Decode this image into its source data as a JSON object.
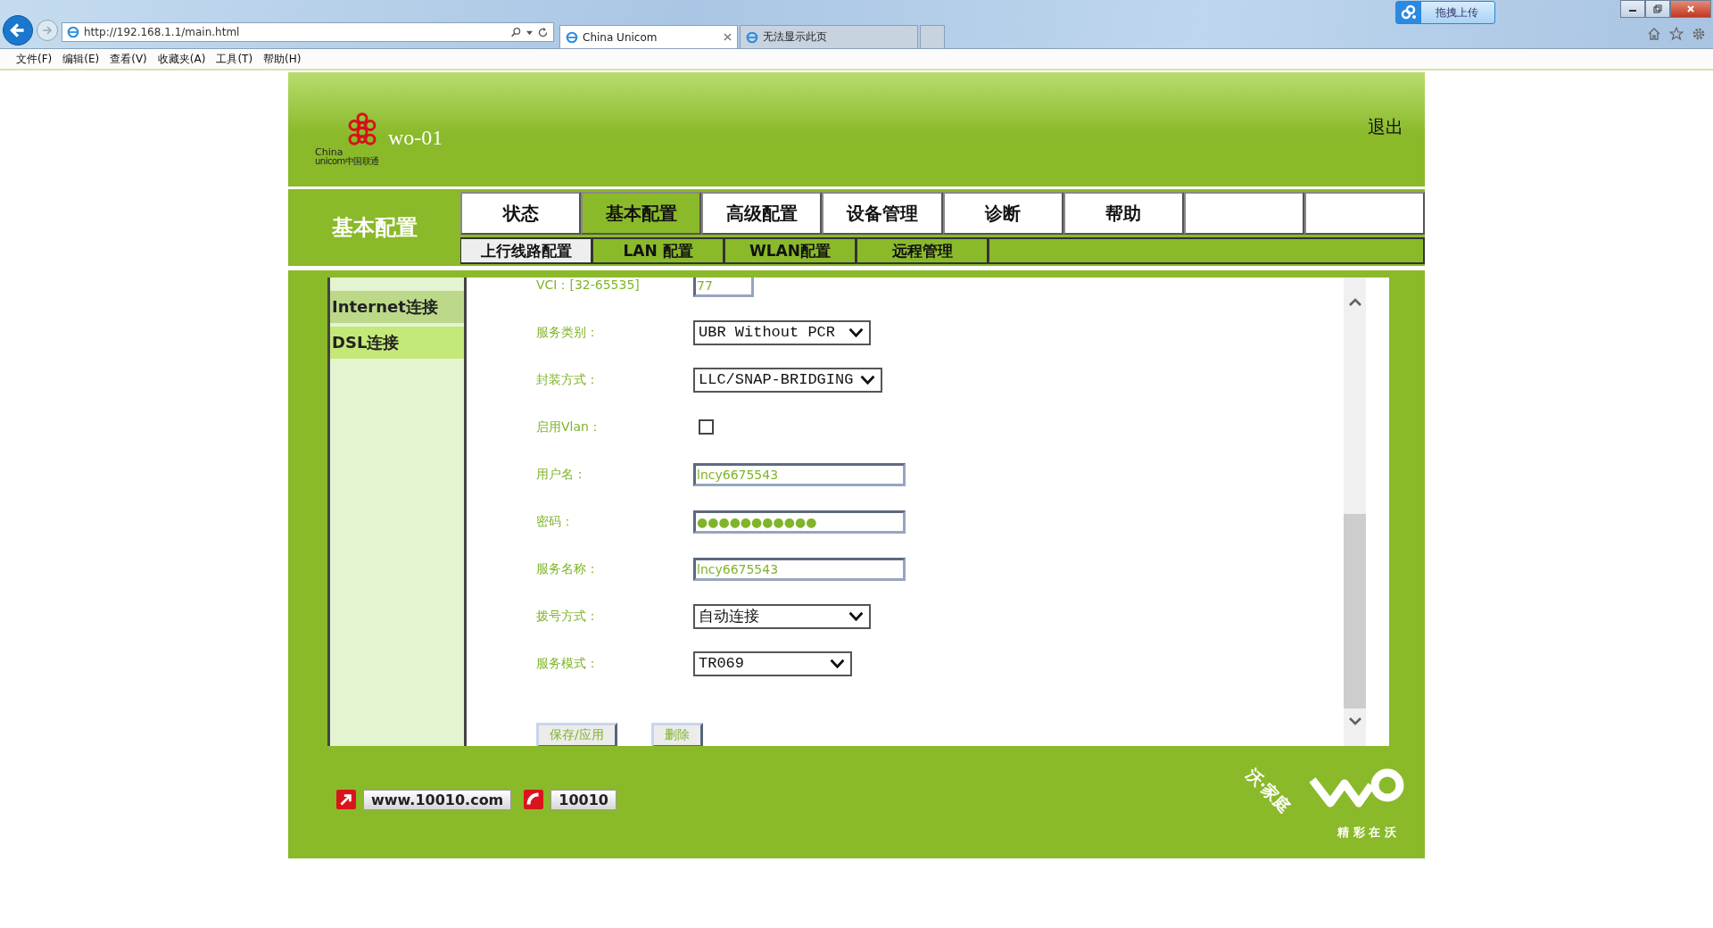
{
  "browser": {
    "address": "http://192.168.1.1/main.html",
    "tabs": [
      {
        "title": "China Unicom",
        "selected": true
      },
      {
        "title": "无法显示此页",
        "selected": false
      }
    ],
    "upload_button": "拖拽上传",
    "menu": [
      "文件(F)",
      "编辑(E)",
      "查看(V)",
      "收藏夹(A)",
      "工具(T)",
      "帮助(H)"
    ]
  },
  "header": {
    "logo_lines": [
      "China",
      "unicom中国联通"
    ],
    "device": "wo-01",
    "logout": "退出"
  },
  "section_title": "基本配置",
  "nav_tabs": [
    {
      "kind": "tab",
      "label": "状态",
      "selected": false
    },
    {
      "kind": "tab",
      "label": "基本配置",
      "selected": true
    },
    {
      "kind": "tab",
      "label": "高级配置",
      "selected": false
    },
    {
      "kind": "tab",
      "label": "设备管理",
      "selected": false
    },
    {
      "kind": "tab",
      "label": "诊断",
      "selected": false
    },
    {
      "kind": "tab",
      "label": "帮助",
      "selected": false
    },
    {
      "kind": "blank",
      "selected": false
    },
    {
      "kind": "blank",
      "selected": false
    }
  ],
  "sub_tabs": [
    {
      "label": "上行线路配置",
      "selected": true
    },
    {
      "label": "LAN 配置",
      "selected": false
    },
    {
      "label": "WLAN配置",
      "selected": false
    },
    {
      "label": "远程管理",
      "selected": false
    }
  ],
  "sidebar": {
    "items": [
      {
        "kind": "group",
        "label": "Internet连接",
        "selected": false
      },
      {
        "kind": "link",
        "label": "DSL连接",
        "selected": true
      }
    ]
  },
  "form": {
    "rows": [
      {
        "kind": "text",
        "label": "VCI：[32-65535]",
        "value": "77"
      },
      {
        "kind": "select",
        "label": "服务类别：",
        "value": "UBR Without PCR"
      },
      {
        "kind": "select",
        "label": "封装方式：",
        "value": "LLC/SNAP-BRIDGING"
      },
      {
        "kind": "checkbox",
        "label": "启用Vlan：",
        "checked": false
      },
      {
        "kind": "text",
        "label": "用户名：",
        "value": "lncy6675543"
      },
      {
        "kind": "password",
        "label": "密码：",
        "value": "●●●●●●●●●●●"
      },
      {
        "kind": "text",
        "label": "服务名称：",
        "value": "lncy6675543"
      },
      {
        "kind": "select",
        "label": "拨号方式：",
        "value": "自动连接"
      },
      {
        "kind": "select",
        "label": "服务模式：",
        "value": "TR069"
      }
    ],
    "buttons": [
      "保存/应用",
      "删除"
    ]
  },
  "footer": {
    "website": "www.10010.com",
    "hotline": "10010",
    "brand": "沃·家庭",
    "slogan": "精 彩 在 沃"
  }
}
